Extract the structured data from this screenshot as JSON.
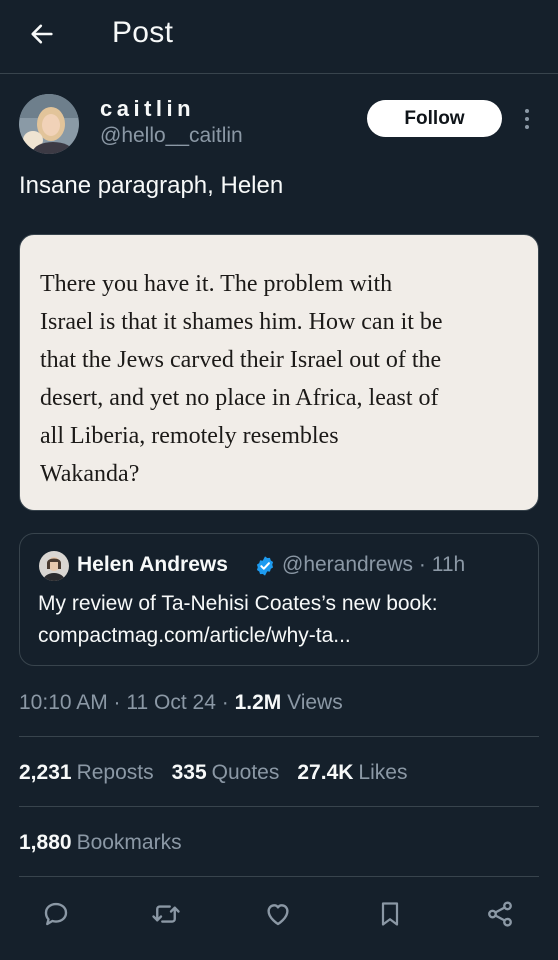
{
  "header": {
    "title": "Post",
    "back_icon": "arrow-left-icon"
  },
  "author": {
    "display_name": "caitlin",
    "handle": "@hello__caitlin",
    "follow_label": "Follow",
    "more_icon": "more-vertical-icon"
  },
  "post": {
    "text": "Insane paragraph, Helen",
    "image_text": "There you have it. The problem with\nIsrael is that it shames him. How can it be\nthat the Jews carved their Israel out of the\ndesert, and yet no place in Africa, least of\nall Liberia, remotely resembles\nWakanda?"
  },
  "quote": {
    "name": "Helen Andrews",
    "handle_time": "@herandrews · 11h",
    "line1": "My review of Ta-Nehisi Coates’s new book:",
    "line2": "compactmag.com/article/why-ta..."
  },
  "meta": {
    "timestamp": "10:10 AM · 11 Oct 24 · ",
    "views_count": "1.2M",
    "views_label": " Views"
  },
  "stats": {
    "reposts_count": "2,231",
    "reposts_label": "Reposts",
    "quotes_count": "335",
    "quotes_label": "Quotes",
    "likes_count": "27.4K",
    "likes_label": "Likes",
    "bookmarks_count": "1,880",
    "bookmarks_label": "Bookmarks"
  },
  "actions": [
    "reply-icon",
    "repost-icon",
    "like-icon",
    "bookmark-icon",
    "share-icon"
  ],
  "colors": {
    "background": "#15202b",
    "text": "#f7f9f9",
    "muted": "#8b98a5",
    "border": "#38444d",
    "verified": "#1d9bf0",
    "image_bg": "#f1ede8"
  }
}
